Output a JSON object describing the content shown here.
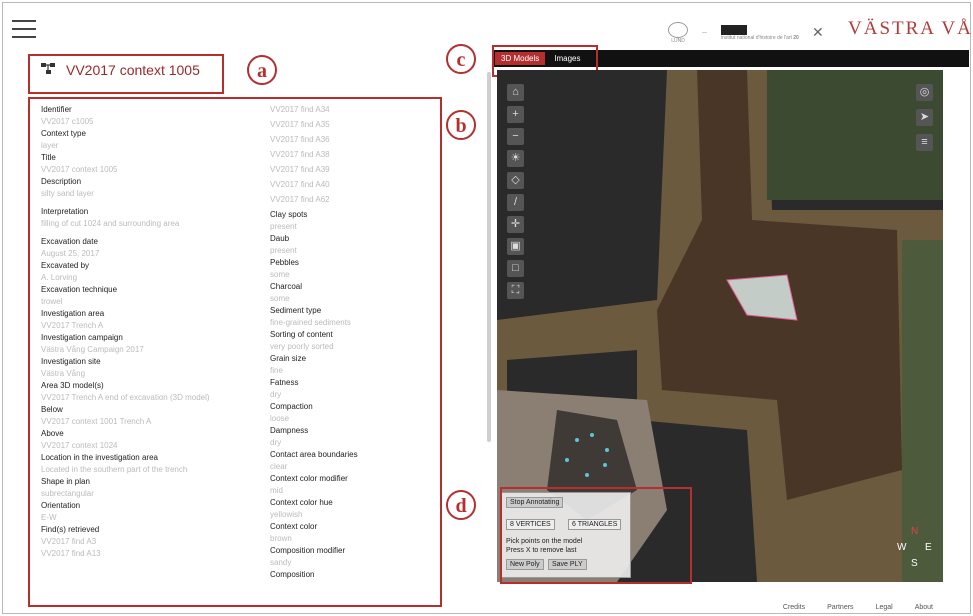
{
  "header": {
    "logo_text": "VÄSTRA VÅNG",
    "small_logo_1": "LUND",
    "small_logo_2": "institut national d'histoire de l'art",
    "small_logo_3": "20"
  },
  "title": "VV2017 context 1005",
  "annotations": {
    "a": "a",
    "b": "b",
    "c": "c",
    "d": "d"
  },
  "left_fields": [
    {
      "label": "Identifier",
      "value": "VV2017 c1005"
    },
    {
      "label": "Context type",
      "value": "layer"
    },
    {
      "label": "Title",
      "value": "VV2017 context 1005"
    },
    {
      "label": "Description",
      "value": "silty sand layer"
    },
    {
      "label": "Interpretation",
      "value": "filling of cut 1024 and surrounding area"
    },
    {
      "label": "Excavation date",
      "value": "August 25, 2017"
    },
    {
      "label": "Excavated by",
      "value": "A. Lorving"
    },
    {
      "label": "Excavation technique",
      "value": "trowel"
    },
    {
      "label": "Investigation area",
      "value": "VV2017 Trench A"
    },
    {
      "label": "Investigation campaign",
      "value": "Västra Vång Campaign 2017"
    },
    {
      "label": "Investigation site",
      "value": "Västra Vång"
    },
    {
      "label": "Area 3D model(s)",
      "value": "VV2017 Trench A end of excavation (3D model)"
    },
    {
      "label": "Below",
      "value": "VV2017 context 1001 Trench A"
    },
    {
      "label": "Above",
      "value": "VV2017 context 1024"
    },
    {
      "label": "Location in the investigation area",
      "value": "Located in the southern part of the trench"
    },
    {
      "label": "Shape in plan",
      "value": "subrectangular"
    },
    {
      "label": "Orientation",
      "value": "E-W"
    },
    {
      "label": "Find(s) retrieved",
      "value": "VV2017 find A3"
    }
  ],
  "left_trailing_value": "VV2017 find A13",
  "right_leading_values": [
    "VV2017 find A34",
    "VV2017 find A35",
    "VV2017 find A36",
    "VV2017 find A38",
    "VV2017 find A39",
    "VV2017 find A40",
    "VV2017 find A62"
  ],
  "right_fields": [
    {
      "label": "Clay spots",
      "value": "present"
    },
    {
      "label": "Daub",
      "value": "present"
    },
    {
      "label": "Pebbles",
      "value": "some"
    },
    {
      "label": "Charcoal",
      "value": "some"
    },
    {
      "label": "Sediment type",
      "value": "fine-grained sediments"
    },
    {
      "label": "Sorting of content",
      "value": "very poorly sorted"
    },
    {
      "label": "Grain size",
      "value": "fine"
    },
    {
      "label": "Fatness",
      "value": "dry"
    },
    {
      "label": "Compaction",
      "value": "loose"
    },
    {
      "label": "Dampness",
      "value": "dry"
    },
    {
      "label": "Contact area boundaries",
      "value": "clear"
    },
    {
      "label": "Context color modifier",
      "value": "mid"
    },
    {
      "label": "Context color hue",
      "value": "yellowish"
    },
    {
      "label": "Context color",
      "value": "brown"
    },
    {
      "label": "Composition modifier",
      "value": "sandy"
    },
    {
      "label": "Composition",
      "value": ""
    }
  ],
  "tabs": [
    {
      "label": "3D Models"
    },
    {
      "label": "Images"
    }
  ],
  "annotate_panel": {
    "stop_label": "Stop Annotating",
    "vertices_label": "8 VERTICES",
    "triangles_label": "6 TRIANGLES",
    "instruction_1": "Pick points on the model",
    "instruction_2": "Press X to remove last",
    "new_poly_label": "New Poly",
    "save_ply_label": "Save PLY"
  },
  "compass": {
    "n": "N",
    "w": "W",
    "e": "E",
    "s": "S"
  },
  "footer": [
    {
      "label": "Credits"
    },
    {
      "label": "Partners"
    },
    {
      "label": "Legal"
    },
    {
      "label": "About"
    }
  ],
  "colors": {
    "accent": "#b52f2f",
    "title": "#9c2727"
  }
}
